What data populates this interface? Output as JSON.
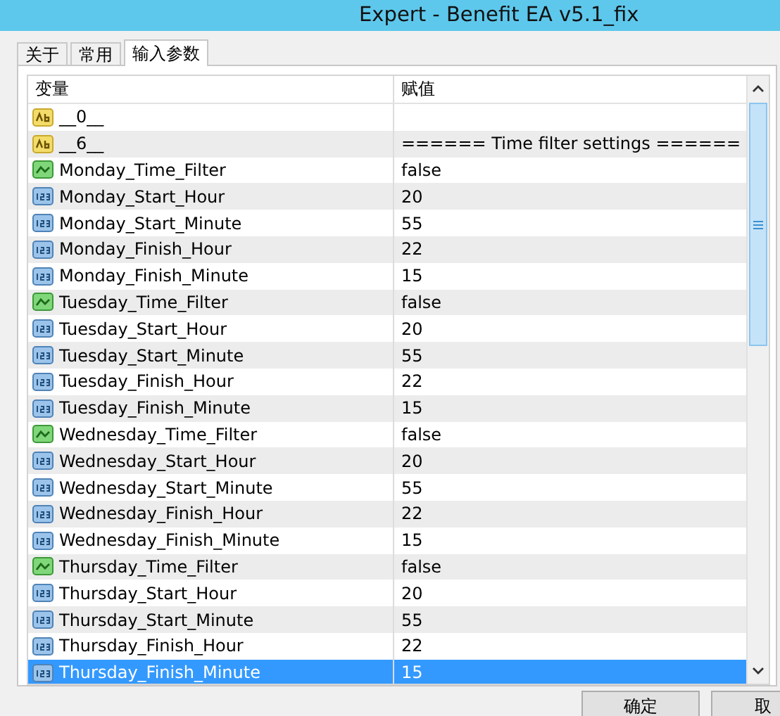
{
  "window": {
    "title": "Expert - Benefit EA v5.1_fix"
  },
  "tabs": [
    {
      "label": "关于",
      "selected": false
    },
    {
      "label": "常用",
      "selected": false
    },
    {
      "label": "输入参数",
      "selected": true
    }
  ],
  "table": {
    "columns": [
      "变量",
      "赋值"
    ],
    "rows": [
      {
        "kind": "string",
        "name": "__0__",
        "selected": false
      },
      {
        "kind": "string",
        "name": "__6__",
        "value": "====== Time filter settings ======",
        "selected": false
      },
      {
        "kind": "bool",
        "name": "Monday_Time_Filter",
        "value": "false",
        "selected": false
      },
      {
        "kind": "int",
        "name": "Monday_Start_Hour",
        "value": "20",
        "selected": false
      },
      {
        "kind": "int",
        "name": "Monday_Start_Minute",
        "value": "55",
        "selected": false
      },
      {
        "kind": "int",
        "name": "Monday_Finish_Hour",
        "value": "22",
        "selected": false
      },
      {
        "kind": "int",
        "name": "Monday_Finish_Minute",
        "value": "15",
        "selected": false
      },
      {
        "kind": "bool",
        "name": "Tuesday_Time_Filter",
        "value": "false",
        "selected": false
      },
      {
        "kind": "int",
        "name": "Tuesday_Start_Hour",
        "value": "20",
        "selected": false
      },
      {
        "kind": "int",
        "name": "Tuesday_Start_Minute",
        "value": "55",
        "selected": false
      },
      {
        "kind": "int",
        "name": "Tuesday_Finish_Hour",
        "value": "22",
        "selected": false
      },
      {
        "kind": "int",
        "name": "Tuesday_Finish_Minute",
        "value": "15",
        "selected": false
      },
      {
        "kind": "bool",
        "name": "Wednesday_Time_Filter",
        "value": "false",
        "selected": false
      },
      {
        "kind": "int",
        "name": "Wednesday_Start_Hour",
        "value": "20",
        "selected": false
      },
      {
        "kind": "int",
        "name": "Wednesday_Start_Minute",
        "value": "55",
        "selected": false
      },
      {
        "kind": "int",
        "name": "Wednesday_Finish_Hour",
        "value": "22",
        "selected": false
      },
      {
        "kind": "int",
        "name": "Wednesday_Finish_Minute",
        "value": "15",
        "selected": false
      },
      {
        "kind": "bool",
        "name": "Thursday_Time_Filter",
        "value": "false",
        "selected": false
      },
      {
        "kind": "int",
        "name": "Thursday_Start_Hour",
        "value": "20",
        "selected": false
      },
      {
        "kind": "int",
        "name": "Thursday_Start_Minute",
        "value": "55",
        "selected": false
      },
      {
        "kind": "int",
        "name": "Thursday_Finish_Hour",
        "value": "22",
        "selected": false
      },
      {
        "kind": "int",
        "name": "Thursday_Finish_Minute",
        "value": "15",
        "selected": true
      }
    ]
  },
  "buttons": [
    "确定",
    "取"
  ]
}
